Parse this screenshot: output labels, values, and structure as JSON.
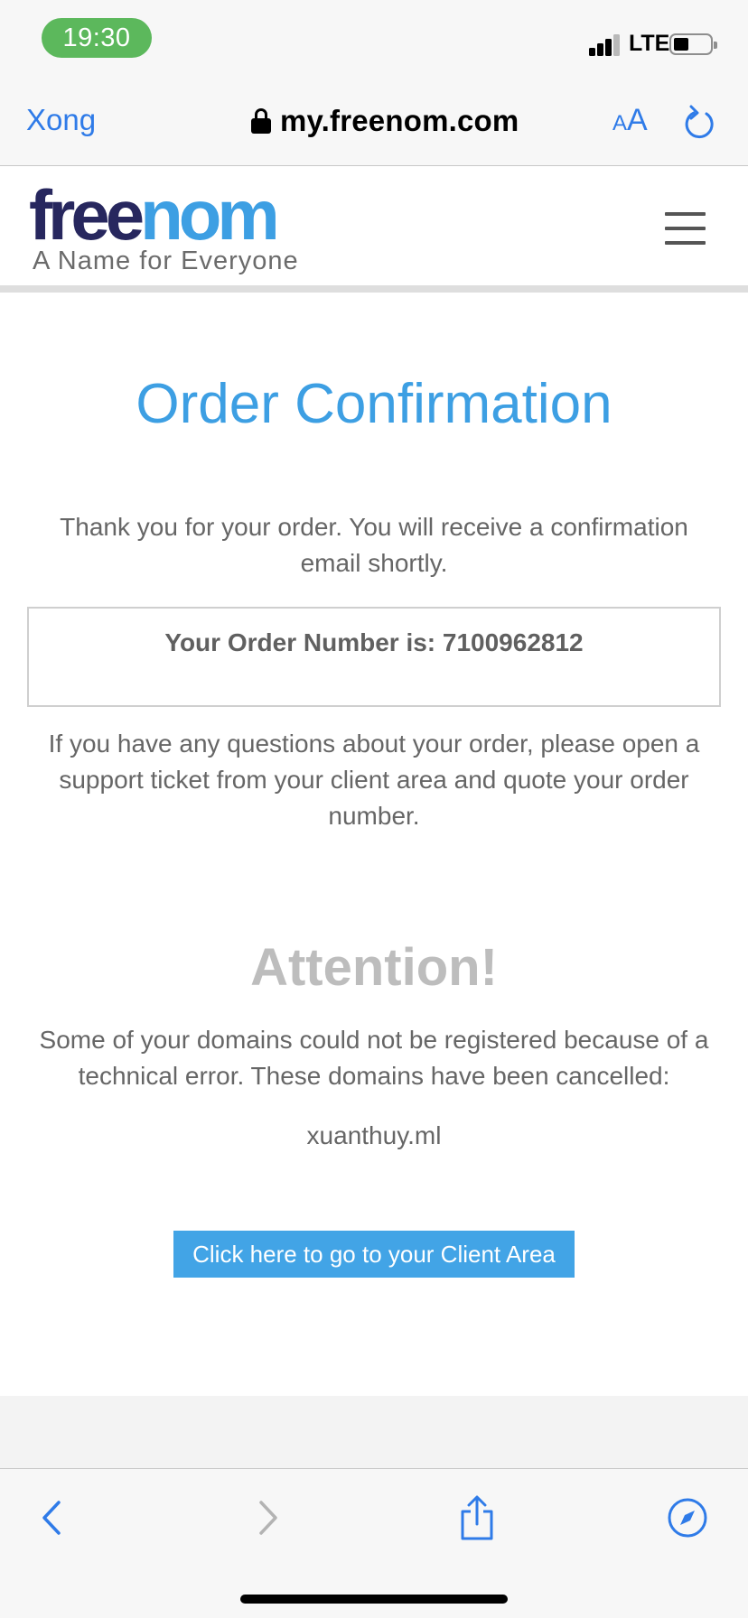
{
  "status_bar": {
    "time": "19:30",
    "network": "LTE",
    "icons": [
      "signal-icon",
      "battery-icon"
    ]
  },
  "browser": {
    "done_label": "Xong",
    "url": "my.freenom.com",
    "text_size_small": "A",
    "text_size_large": "A",
    "accent_color": "#2f7be8",
    "icons": [
      "lock-icon",
      "reload-icon",
      "back-icon",
      "forward-icon",
      "share-icon",
      "compass-icon"
    ]
  },
  "site": {
    "logo_part1": "free",
    "logo_part2": "nom",
    "tagline": "A Name for Everyone",
    "brand_dark": "#27275e",
    "brand_light": "#3d9fe3",
    "menu_icon": "hamburger-menu-icon"
  },
  "main": {
    "title": "Order Confirmation",
    "thanks": "Thank you for your order. You will receive a confirmation email shortly.",
    "order_number_text": "Your Order Number is: 7100962812",
    "questions": "If you have any questions about your order, please open a support ticket from your client area and quote your order number.",
    "attention_title": "Attention!",
    "attention_text": "Some of your domains could not be registered because of a technical error. These domains have been cancelled:",
    "cancelled_domain": "xuanthuy.ml",
    "client_area_button": "Click here to go to your Client Area"
  }
}
